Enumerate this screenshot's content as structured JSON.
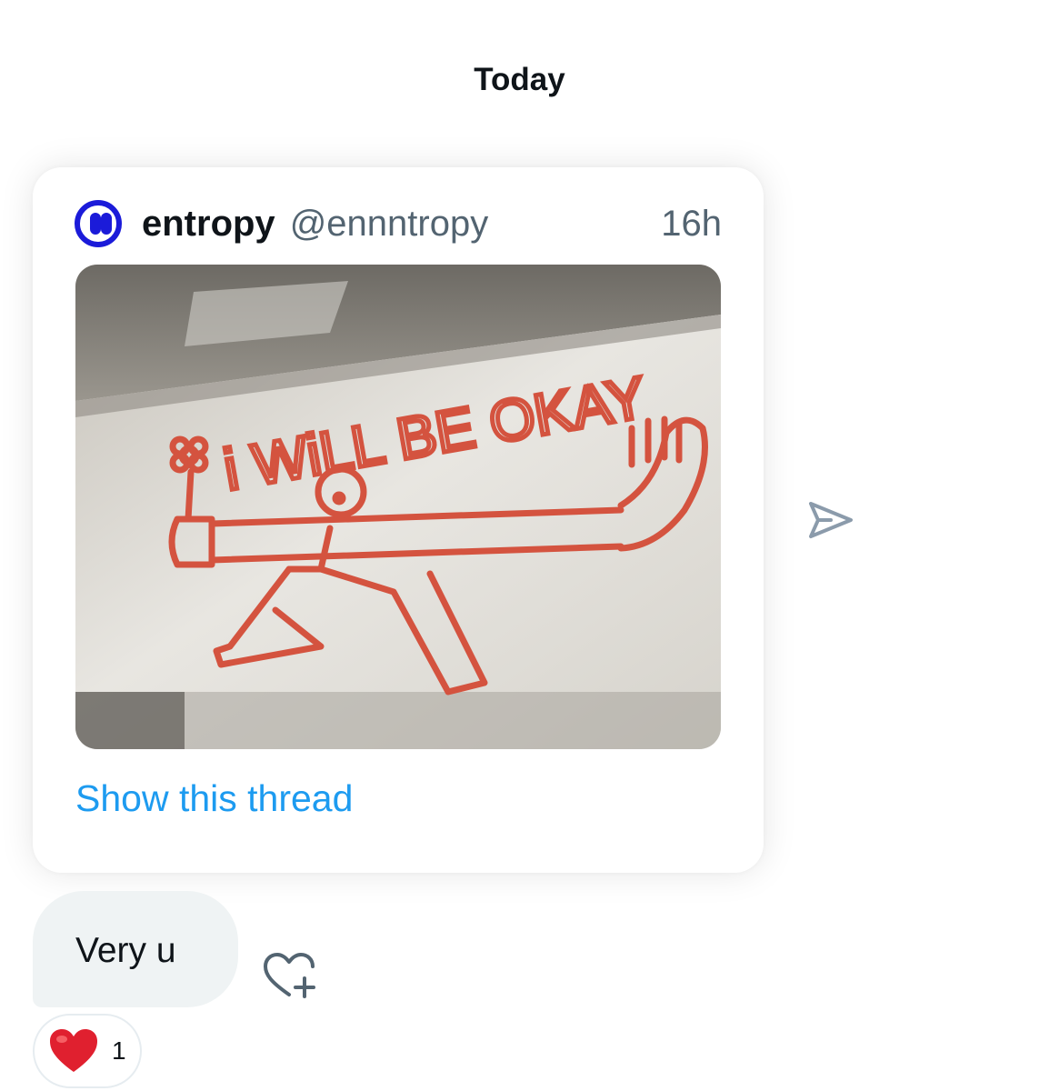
{
  "conversation": {
    "date_divider": "Today"
  },
  "shared_tweet": {
    "author_name": "entropy",
    "author_handle": "@ennntropy",
    "timestamp": "16h",
    "image_text": "i WiLL BE OKAY",
    "show_thread_label": "Show this thread"
  },
  "message": {
    "text": "Very u"
  },
  "reaction": {
    "emoji": "red-heart",
    "count": "1"
  },
  "icons": {
    "share": "share-send-icon",
    "add_reaction": "heart-plus-icon"
  },
  "colors": {
    "link": "#1d9bf0",
    "secondary_text": "#536471",
    "bubble_bg": "#eff3f4",
    "avatar_blue": "#1b1bd9",
    "graffiti_red": "#d4533f"
  }
}
